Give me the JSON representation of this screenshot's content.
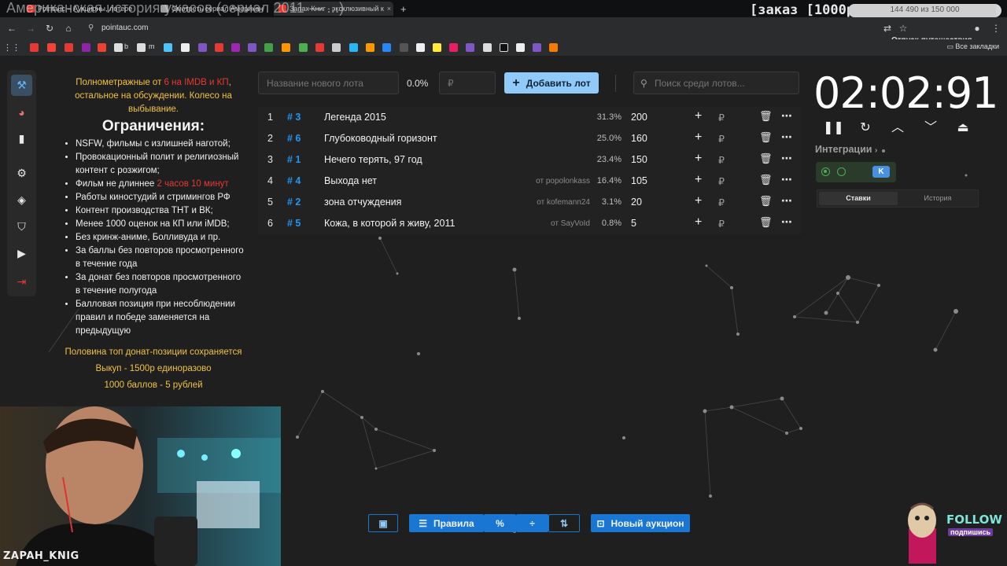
{
  "overlay": {
    "title": "Американская история ужасов (сериал 2011 — ...)",
    "order_badge": "[заказ [1000р]",
    "progress_text": "144 490 из 150 000",
    "progress_fraction": 0.963,
    "progress_sub": "Отпуск-путешествия"
  },
  "browser": {
    "tabs": [
      {
        "label": "Pointauc – Аукционы, лотере",
        "fav_color": "#e53935"
      },
      {
        "label": "Смотреть сериал Американ",
        "fav_color": "#9e9e9e"
      },
      {
        "label": "Запах Книг - эксклюзивный к",
        "fav_color": "#e53935"
      }
    ],
    "url": "pointauc.com",
    "all_bookmarks": "Все закладки",
    "bookmark_labels": [
      "b",
      "m"
    ]
  },
  "rules": {
    "intro_1": "Полнометражные от ",
    "intro_red": "6 на IMDB и КП",
    "intro_2": ", остальное на обсуждении. Колесо на выбывание.",
    "heading": "Ограничения:",
    "items": [
      "NSFW, фильмы с излишней наготой;",
      "Провокационный полит и религиозный контент с розжигом;",
      "Работы киностудий и стримингов РФ",
      "Контент производства ТНТ и ВК;",
      "Менее 1000 оценок на КП или iMDB;",
      "Без кринж-аниме, Болливуда и пр.",
      "За баллы без повторов просмотренного в течение года",
      "За донат без повторов просмотренного в течение полугода",
      "Балловая позиция при несоблюдении правил и победе заменяется на предыдущую"
    ],
    "duration_prefix": "Фильм не длиннее ",
    "duration_red": "2 часов 10 минут",
    "footer_1": "Половина топ донат-позиции сохраняется",
    "footer_2": "Выкуп - 1500р единоразово",
    "footer_3": "1000 баллов - 5 рублей"
  },
  "toolbar": {
    "lot_name_placeholder": "Название нового лота",
    "percent": "0.0%",
    "amount_placeholder": "₽",
    "add_lot": "Добавить лот",
    "search_placeholder": "Поиск среди лотов..."
  },
  "lots": [
    {
      "num": "1",
      "id": "# 3",
      "name": "Легенда 2015",
      "from": "",
      "pct": "31.3%",
      "amount": "200"
    },
    {
      "num": "2",
      "id": "# 6",
      "name": "Глубоководный горизонт",
      "from": "",
      "pct": "25.0%",
      "amount": "160"
    },
    {
      "num": "3",
      "id": "# 1",
      "name": "Нечего терять, 97 год",
      "from": "",
      "pct": "23.4%",
      "amount": "150"
    },
    {
      "num": "4",
      "id": "# 4",
      "name": "Выхода нет",
      "from": "от popolonkass",
      "pct": "16.4%",
      "amount": "105"
    },
    {
      "num": "5",
      "id": "# 2",
      "name": "зона отчуждения",
      "from": "от kofemann24",
      "pct": "3.1%",
      "amount": "20"
    },
    {
      "num": "6",
      "id": "# 5",
      "name": "Кожа, в которой я живу, 2011",
      "from": "от SayVoId",
      "pct": "0.8%",
      "amount": "5"
    }
  ],
  "lot_currency": "₽",
  "timer": {
    "value": "02:02:91"
  },
  "integrations": {
    "label": "Интеграции",
    "tabs": [
      "Ставки",
      "История"
    ]
  },
  "bottom": {
    "rules": "Правила",
    "new_auction": "Новый аукцион"
  },
  "webcam": {
    "name": "ZAPAH_KNIG"
  },
  "follow": {
    "text": "FOLLOW",
    "sub": "подпишись"
  },
  "colors": {
    "accent_blue": "#2196f3",
    "button_blue": "#1976d2",
    "add_button": "#90caf9",
    "yellow_text": "#f0c242",
    "red_text": "#e53935"
  }
}
